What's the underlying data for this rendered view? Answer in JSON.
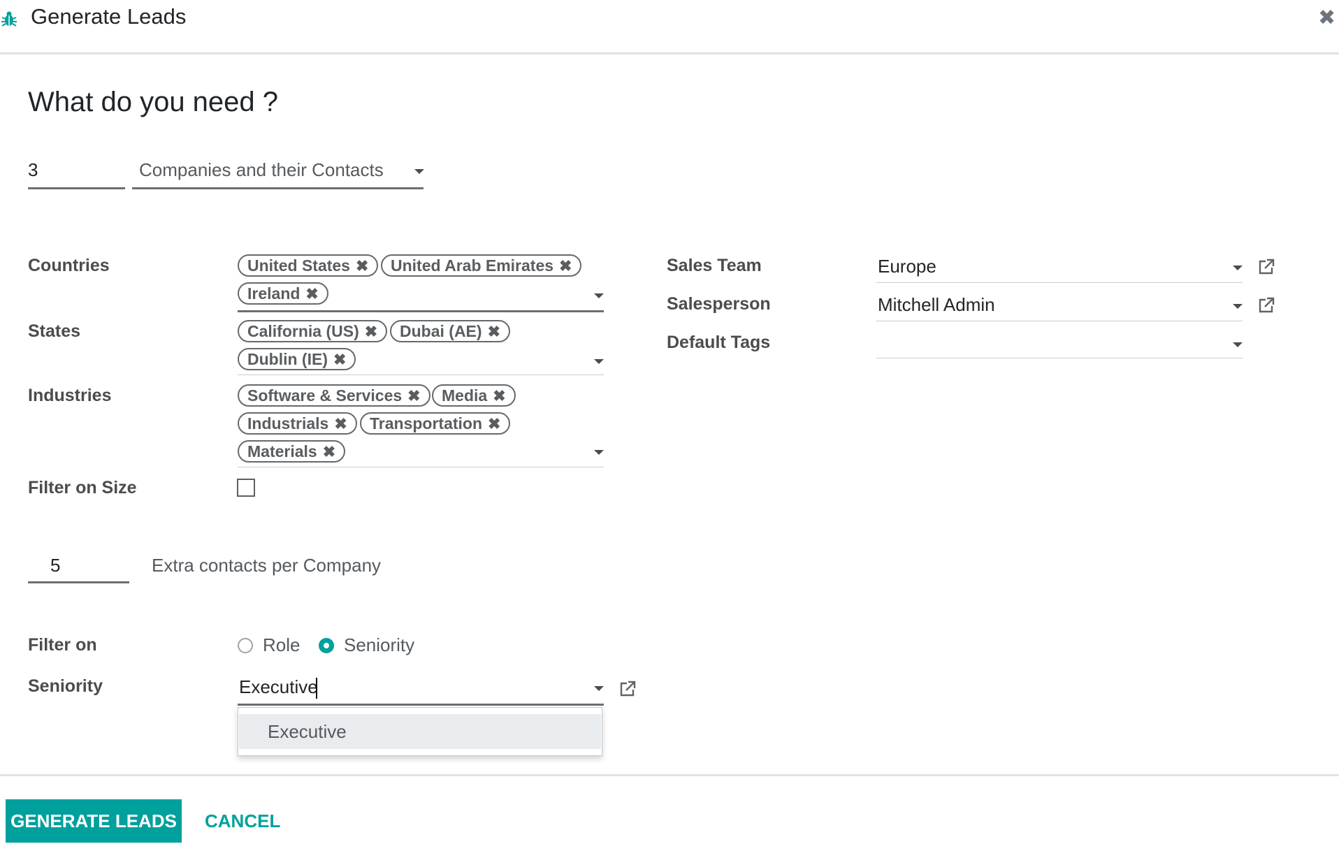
{
  "dialog": {
    "title": "Generate Leads",
    "heading": "What do you need ?"
  },
  "request": {
    "count": "3",
    "type": "Companies and their Contacts"
  },
  "fields": {
    "countries": {
      "label": "Countries",
      "tags": [
        "United States",
        "United Arab Emirates",
        "Ireland"
      ]
    },
    "states": {
      "label": "States",
      "tags": [
        "California (US)",
        "Dubai (AE)",
        "Dublin (IE)"
      ]
    },
    "industries": {
      "label": "Industries",
      "tags": [
        "Software & Services",
        "Media",
        "Industrials",
        "Transportation",
        "Materials"
      ]
    },
    "filter_on_size": {
      "label": "Filter on Size",
      "checked": false
    }
  },
  "contacts": {
    "count": "5",
    "label": "Extra contacts per Company"
  },
  "filter_on": {
    "label": "Filter on",
    "options": [
      "Role",
      "Seniority"
    ],
    "selected": "Seniority"
  },
  "seniority": {
    "label": "Seniority",
    "value": "Executive",
    "suggestions": [
      "Executive"
    ]
  },
  "right": {
    "sales_team": {
      "label": "Sales Team",
      "value": "Europe"
    },
    "salesperson": {
      "label": "Salesperson",
      "value": "Mitchell Admin"
    },
    "default_tags": {
      "label": "Default Tags",
      "value": ""
    }
  },
  "footer": {
    "generate_label": "GENERATE LEADS",
    "cancel_label": "CANCEL"
  },
  "colors": {
    "accent": "#00a09d",
    "tag_border": "#66696c",
    "label": "#4c4c4c"
  }
}
